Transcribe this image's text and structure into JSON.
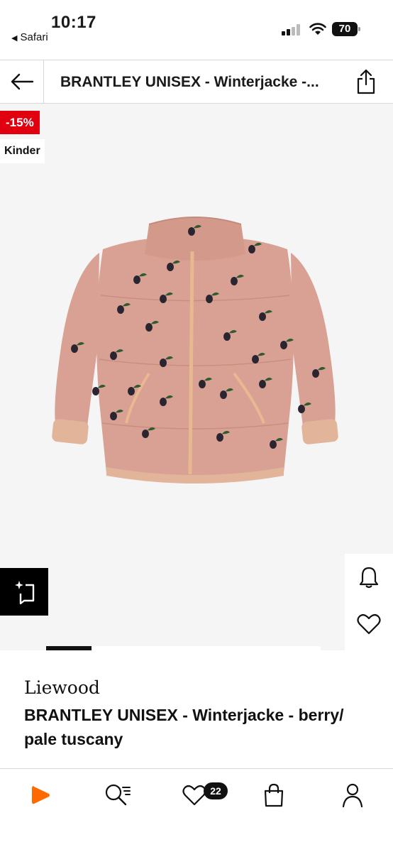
{
  "status_bar": {
    "time": "10:17",
    "back_app": "Safari",
    "battery": "70"
  },
  "header": {
    "title": "BRANTLEY UNISEX - Winterjacke -..."
  },
  "gallery": {
    "discount_badge": "-15%",
    "category_badge": "Kinder",
    "jacket_color": "#d9a193",
    "image_count": 6,
    "active_index": 0
  },
  "product": {
    "brand": "Liewood",
    "name": "BRANTLEY UNISEX - Winterjacke - berry/ pale tuscany"
  },
  "tabbar": {
    "items": [
      "home-icon",
      "search-icon",
      "wishlist-icon",
      "bag-icon",
      "profile-icon"
    ],
    "wishlist_count": "22",
    "accent": "#ff6900"
  }
}
